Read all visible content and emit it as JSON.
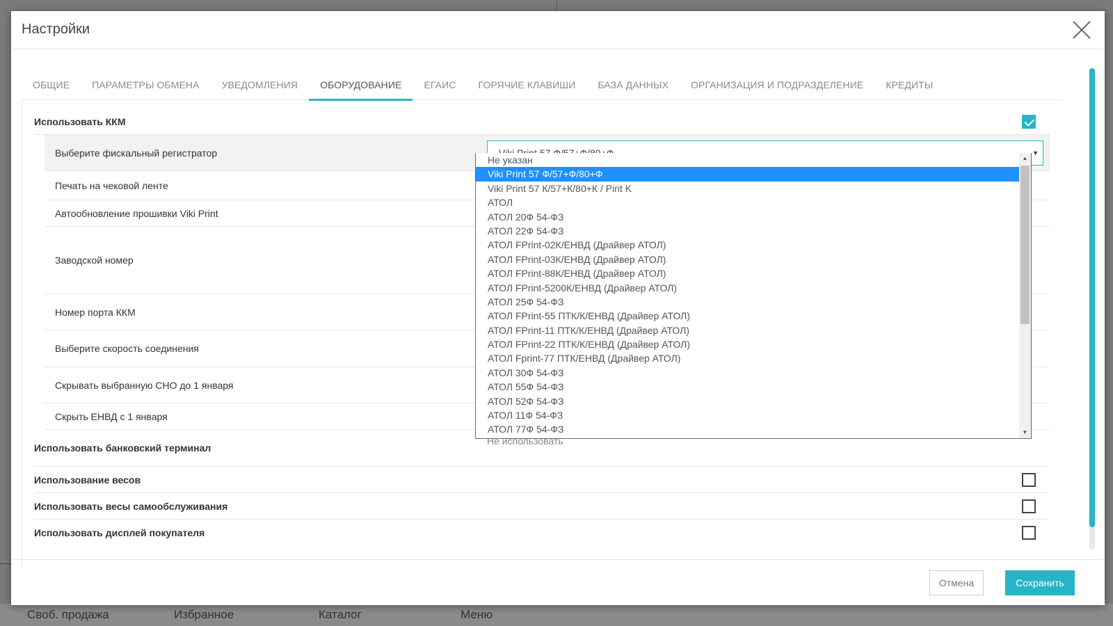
{
  "background": {
    "bottom_items": [
      "Своб. продажа",
      "Избранное",
      "Каталог",
      "Меню"
    ]
  },
  "modal": {
    "title": "Настройки",
    "tabs": [
      {
        "label": "ОБЩИЕ",
        "active": false
      },
      {
        "label": "ПАРАМЕТРЫ ОБМЕНА",
        "active": false
      },
      {
        "label": "УВЕДОМЛЕНИЯ",
        "active": false
      },
      {
        "label": "ОБОРУДОВАНИЕ",
        "active": true
      },
      {
        "label": "ЕГАИС",
        "active": false
      },
      {
        "label": "ГОРЯЧИЕ КЛАВИШИ",
        "active": false
      },
      {
        "label": "БАЗА ДАННЫХ",
        "active": false
      },
      {
        "label": "ОРГАНИЗАЦИЯ И ПОДРАЗДЕЛЕНИЕ",
        "active": false
      },
      {
        "label": "КРЕДИТЫ",
        "active": false
      }
    ],
    "rows": {
      "use_kkm": {
        "label": "Использовать ККМ",
        "checked": true
      },
      "fiscal_registrar": {
        "label": "Выберите фискальный регистратор",
        "value": "Viki Print 57 Ф/57+Ф/80+Ф"
      },
      "print_on_tape": {
        "label": "Печать на чековой ленте"
      },
      "auto_update": {
        "label": "Автообновление прошивки Viki Print"
      },
      "serial_number": {
        "label": "Заводской номер"
      },
      "port_number": {
        "label": "Номер порта ККМ"
      },
      "connection_speed": {
        "label": "Выберите скорость соединения"
      },
      "hide_sno": {
        "label": "Скрывать выбранную СНО до 1 января"
      },
      "hide_envd": {
        "label": "Скрыть ЕНВД с 1 января"
      },
      "use_bank_terminal": {
        "label": "Использовать банковский терминал"
      },
      "use_scales": {
        "label": "Использование весов",
        "checked": false
      },
      "use_self_scales": {
        "label": "Использовать весы самообслуживания",
        "checked": false
      },
      "use_customer_display": {
        "label": "Использовать дисплей покупателя",
        "checked": false
      }
    },
    "dropdown": {
      "items": [
        "Не указан",
        "Viki Print 57 Ф/57+Ф/80+Ф",
        "Viki Print 57 К/57+К/80+К / Pirit K",
        "АТОЛ",
        "АТОЛ 20Ф 54-ФЗ",
        "АТОЛ 22Ф 54-ФЗ",
        "АТОЛ FPrint-02К/ЕНВД (Драйвер АТОЛ)",
        "АТОЛ FPrint-03К/ЕНВД (Драйвер АТОЛ)",
        "АТОЛ FPrint-88К/ЕНВД (Драйвер АТОЛ)",
        "АТОЛ FPrint-5200К/ЕНВД (Драйвер АТОЛ)",
        "АТОЛ 25Ф 54-ФЗ",
        "АТОЛ FPrint-55 ПТК/К/ЕНВД (Драйвер АТОЛ)",
        "АТОЛ FPrint-11 ПТК/К/ЕНВД (Драйвер АТОЛ)",
        "АТОЛ FPrint-22 ПТК/К/ЕНВД (Драйвер АТОЛ)",
        "АТОЛ Fprint-77 ПТК/ЕНВД (Драйвер АТОЛ)",
        "АТОЛ 30Ф 54-ФЗ",
        "АТОЛ 55Ф 54-ФЗ",
        "АТОЛ 52Ф 54-ФЗ",
        "АТОЛ 11Ф 54-ФЗ",
        "АТОЛ 77Ф 54-ФЗ"
      ],
      "selected_index": 1
    },
    "behind_bank_select": "Не использовать",
    "footer": {
      "cancel_label": "Отмена",
      "save_label": "Сохранить"
    }
  },
  "colors": {
    "accent": "#27b4c6",
    "selected": "#1e90ff"
  }
}
